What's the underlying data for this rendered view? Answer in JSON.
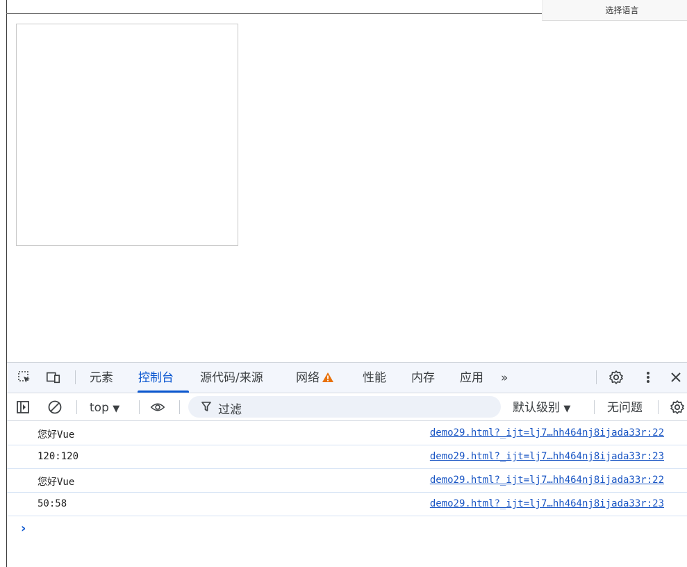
{
  "page": {
    "language_button": "选择语言"
  },
  "devtools": {
    "tabs": [
      {
        "label": "元素"
      },
      {
        "label": "控制台"
      },
      {
        "label": "源代码/来源"
      },
      {
        "label": "网络"
      },
      {
        "label": "性能"
      },
      {
        "label": "内存"
      },
      {
        "label": "应用"
      }
    ],
    "more_tabs": "»",
    "toolbar": {
      "context": "top",
      "filter_placeholder": "过滤",
      "log_level": "默认级别",
      "issues": "无问题"
    },
    "console": {
      "messages": [
        {
          "text": "您好Vue",
          "source": "demo29.html?_ijt=lj7…hh464nj8ijada33r:22"
        },
        {
          "text": "120:120",
          "source": "demo29.html?_ijt=lj7…hh464nj8ijada33r:23"
        },
        {
          "text": "您好Vue",
          "source": "demo29.html?_ijt=lj7…hh464nj8ijada33r:22"
        },
        {
          "text": "50:58",
          "source": "demo29.html?_ijt=lj7…hh464nj8ijada33r:23"
        }
      ],
      "prompt": "›"
    }
  },
  "colors": {
    "accent": "#0b57d0",
    "link": "#1a56c4",
    "warning": "#e8710a",
    "tabbar_bg": "#f3f6fc"
  }
}
